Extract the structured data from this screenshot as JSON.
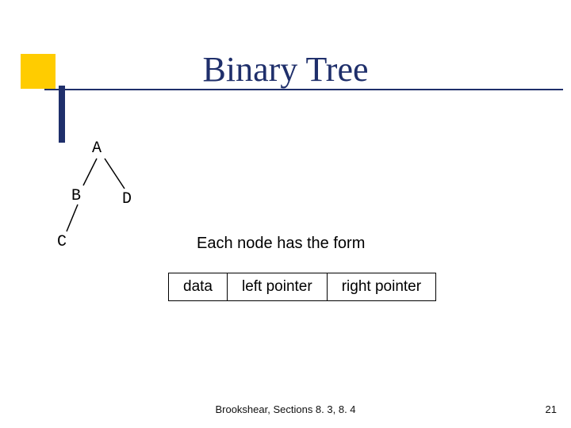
{
  "title": "Binary Tree",
  "tree": {
    "nodes": {
      "a": "A",
      "b": "B",
      "c": "C",
      "d": "D"
    }
  },
  "caption": "Each node has the form",
  "node_struct": {
    "data": "data",
    "left": "left pointer",
    "right": "right pointer"
  },
  "footer": {
    "reference": "Brookshear, Sections 8. 3, 8. 4",
    "page": "21"
  },
  "colors": {
    "accent_yellow": "#ffcc00",
    "accent_navy": "#1f2f6b"
  }
}
